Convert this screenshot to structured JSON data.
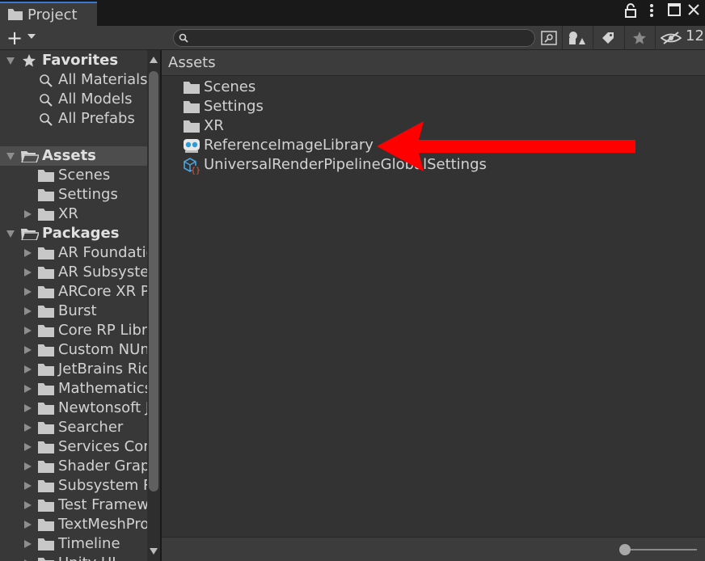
{
  "window": {
    "tab_title": "Project",
    "hidden_count": "12"
  },
  "toolbar": {
    "search_placeholder": "",
    "icons": [
      "plus-icon",
      "search-icon",
      "search-by-type-icon",
      "filter-type-icon",
      "label-icon",
      "favorite-star-icon",
      "hidden-eye-icon"
    ]
  },
  "sidebar": {
    "favorites": {
      "label": "Favorites",
      "items": [
        "All Materials",
        "All Models",
        "All Prefabs"
      ]
    },
    "assets": {
      "label": "Assets",
      "items": [
        "Scenes",
        "Settings",
        "XR"
      ]
    },
    "packages": {
      "label": "Packages",
      "items": [
        "AR Foundation",
        "AR Subsystems",
        "ARCore XR Plugin",
        "Burst",
        "Core RP Library",
        "Custom NUnit",
        "JetBrains Rider Editor",
        "Mathematics",
        "Newtonsoft Json",
        "Searcher",
        "Services Core",
        "Shader Graph",
        "Subsystem Registration",
        "Test Framework",
        "TextMeshPro",
        "Timeline",
        "Unity UI"
      ]
    }
  },
  "main": {
    "breadcrumb": "Assets",
    "items": [
      "Scenes",
      "Settings",
      "XR",
      "ReferenceImageLibrary",
      "UniversalRenderPipelineGlobalSettings"
    ]
  },
  "colors": {
    "annotation_arrow": "#ff0000",
    "accent_tab": "#3a7ad6"
  }
}
